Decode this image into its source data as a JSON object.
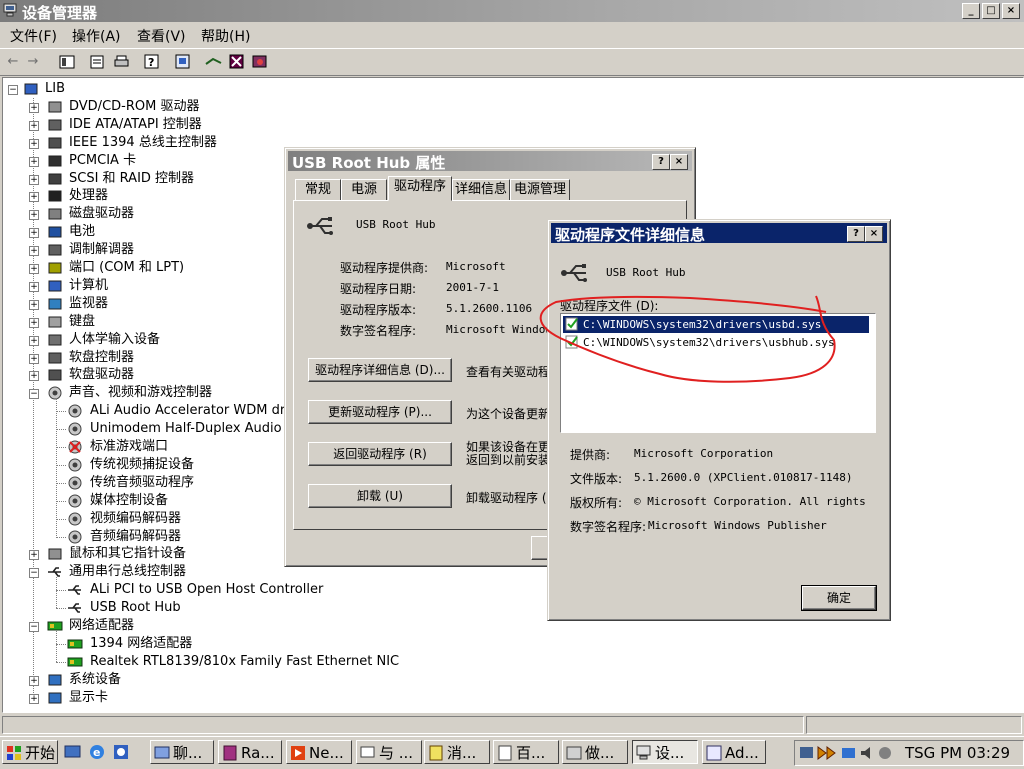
{
  "window": {
    "title": "设备管理器",
    "caption_buttons": [
      "_",
      "□",
      "×"
    ]
  },
  "menu": [
    "文件(F)",
    "操作(A)",
    "查看(V)",
    "帮助(H)"
  ],
  "toolbar_icons": [
    "back-arrow-icon",
    "forward-arrow-icon",
    "view-icon",
    "properties-icon",
    "print-icon",
    "help-icon",
    "refresh-icon",
    "scan-hardware-icon",
    "disable-device-icon",
    "uninstall-icon"
  ],
  "tree": {
    "root": "LIB",
    "items": [
      {
        "label": "DVD/CD-ROM 驱动器",
        "icon": "cdrom-icon"
      },
      {
        "label": "IDE ATA/ATAPI 控制器",
        "icon": "ide-controller-icon"
      },
      {
        "label": "IEEE 1394 总线主控制器",
        "icon": "ieee1394-icon"
      },
      {
        "label": "PCMCIA 卡",
        "icon": "pcmcia-icon"
      },
      {
        "label": "SCSI 和 RAID 控制器",
        "icon": "scsi-icon"
      },
      {
        "label": "处理器",
        "icon": "processor-icon"
      },
      {
        "label": "磁盘驱动器",
        "icon": "disk-drive-icon"
      },
      {
        "label": "电池",
        "icon": "battery-icon"
      },
      {
        "label": "调制解调器",
        "icon": "modem-icon"
      },
      {
        "label": "端口 (COM 和 LPT)",
        "icon": "port-icon"
      },
      {
        "label": "计算机",
        "icon": "computer-icon"
      },
      {
        "label": "监视器",
        "icon": "monitor-icon"
      },
      {
        "label": "键盘",
        "icon": "keyboard-icon"
      },
      {
        "label": "人体学输入设备",
        "icon": "hid-icon"
      },
      {
        "label": "软盘控制器",
        "icon": "floppy-controller-icon"
      },
      {
        "label": "软盘驱动器",
        "icon": "floppy-drive-icon"
      },
      {
        "label": "声音、视频和游戏控制器",
        "icon": "sound-icon",
        "expanded": true
      },
      {
        "label": "ALi Audio Accelerator WDM driver",
        "icon": "sound-device-icon",
        "child": true
      },
      {
        "label": "Unimodem Half-Duplex Audio Devi",
        "icon": "sound-device-icon",
        "child": true
      },
      {
        "label": "标准游戏端口",
        "icon": "game-port-disabled-icon",
        "child": true
      },
      {
        "label": "传统视频捕捉设备",
        "icon": "sound-device-icon",
        "child": true
      },
      {
        "label": "传统音频驱动程序",
        "icon": "sound-device-icon",
        "child": true
      },
      {
        "label": "媒体控制设备",
        "icon": "sound-device-icon",
        "child": true
      },
      {
        "label": "视频编码解码器",
        "icon": "sound-device-icon",
        "child": true
      },
      {
        "label": "音频编码解码器",
        "icon": "sound-device-icon",
        "child": true
      },
      {
        "label": "鼠标和其它指针设备",
        "icon": "mouse-icon"
      },
      {
        "label": "通用串行总线控制器",
        "icon": "usb-icon",
        "expanded": true
      },
      {
        "label": "ALi PCI to USB Open Host Controller",
        "icon": "usb-icon",
        "child": true
      },
      {
        "label": "USB Root Hub",
        "icon": "usb-icon",
        "child": true
      },
      {
        "label": "网络适配器",
        "icon": "network-adapter-icon",
        "expanded": true
      },
      {
        "label": "1394 网络适配器",
        "icon": "network-adapter-icon",
        "child": true
      },
      {
        "label": "Realtek RTL8139/810x Family Fast Ethernet NIC",
        "icon": "network-adapter-icon",
        "child": true
      },
      {
        "label": "系统设备",
        "icon": "system-device-icon"
      },
      {
        "label": "显示卡",
        "icon": "display-adapter-icon"
      }
    ]
  },
  "props": {
    "title": "USB Root Hub 属性",
    "tabs": [
      "常规",
      "电源",
      "驱动程序",
      "详细信息",
      "电源管理"
    ],
    "selected_tab": "驱动程序",
    "device_name": "USB Root Hub",
    "fields": [
      {
        "label": "驱动程序提供商:",
        "value": "Microsoft"
      },
      {
        "label": "驱动程序日期:",
        "value": "2001-7-1"
      },
      {
        "label": "驱动程序版本:",
        "value": "5.1.2600.1106"
      },
      {
        "label": "数字签名程序:",
        "value": "Microsoft Windows"
      }
    ],
    "buttons": [
      {
        "label": "驱动程序详细信息 (D)...",
        "desc": "查看有关驱动程"
      },
      {
        "label": "更新驱动程序 (P)...",
        "desc": "为这个设备更新"
      },
      {
        "label": "返回驱动程序 (R)",
        "desc": "如果该设备在更\n返回到以前安装"
      },
      {
        "label": "卸载 (U)",
        "desc": "卸载驱动程序 ("
      }
    ]
  },
  "details": {
    "title": "驱动程序文件详细信息",
    "device_name": "USB Root Hub",
    "files_label": "驱动程序文件 (D):",
    "files": [
      "C:\\WINDOWS\\system32\\drivers\\usbd.sys",
      "C:\\WINDOWS\\system32\\drivers\\usbhub.sys"
    ],
    "provider_label": "提供商:",
    "provider": "Microsoft Corporation",
    "version_label": "文件版本:",
    "version": "5.1.2600.0 (XPClient.010817-1148)",
    "copyright_label": "版权所有:",
    "copyright": "© Microsoft Corporation. All rights",
    "signer_label": "数字签名程序:",
    "signer": "Microsoft Windows Publisher",
    "ok": "确定"
  },
  "taskbar": {
    "start": "开始",
    "tasks": [
      "聊...",
      "Ra...",
      "Ne...",
      "与 ...",
      "消...",
      "百...",
      "做...",
      "设...",
      "Ad..."
    ],
    "active_task": "设...",
    "clock": "TSG PM 03:29"
  },
  "annotation_color": "#e02020"
}
